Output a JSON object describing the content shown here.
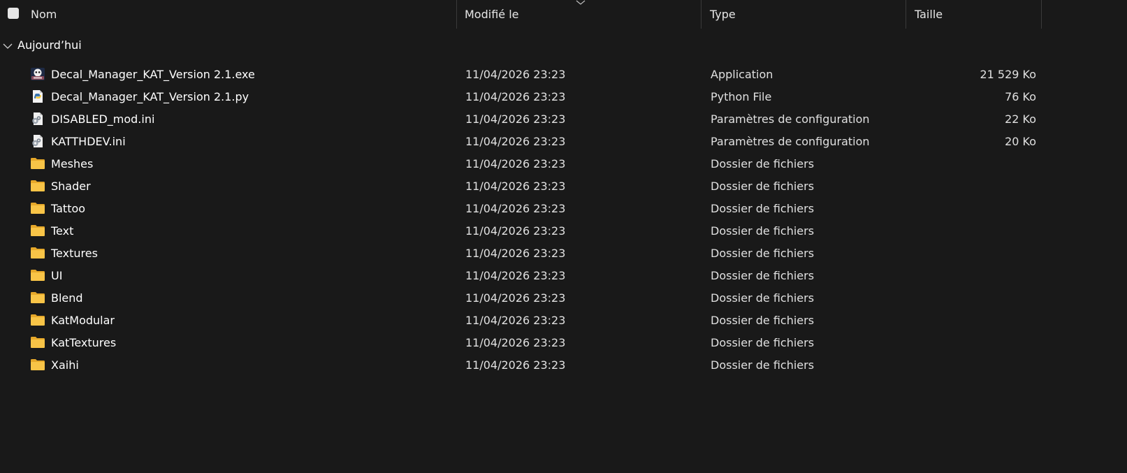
{
  "header": {
    "columns": {
      "name": "Nom",
      "modified": "Modifié le",
      "type": "Type",
      "size": "Taille"
    }
  },
  "group": {
    "label": "Aujourd’hui"
  },
  "colors": {
    "background": "#191919",
    "folder": "#f8c447",
    "folder_dark": "#e6a82a",
    "text": "#ffffff",
    "divider": "#3a3a3a"
  },
  "files": [
    {
      "name": "Decal_Manager_KAT_Version 2.1.exe",
      "modified": "11/04/2026 23:23",
      "type": "Application",
      "size": "21 529 Ko",
      "icon": "app-exe-icon"
    },
    {
      "name": "Decal_Manager_KAT_Version 2.1.py",
      "modified": "11/04/2026 23:23",
      "type": "Python File",
      "size": "76 Ko",
      "icon": "python-file-icon"
    },
    {
      "name": "DISABLED_mod.ini",
      "modified": "11/04/2026 23:23",
      "type": "Paramètres de configuration",
      "size": "22 Ko",
      "icon": "config-file-icon"
    },
    {
      "name": "KATTHDEV.ini",
      "modified": "11/04/2026 23:23",
      "type": "Paramètres de configuration",
      "size": "20 Ko",
      "icon": "config-file-icon"
    },
    {
      "name": "Meshes",
      "modified": "11/04/2026 23:23",
      "type": "Dossier de fichiers",
      "size": "",
      "icon": "folder-icon"
    },
    {
      "name": "Shader",
      "modified": "11/04/2026 23:23",
      "type": "Dossier de fichiers",
      "size": "",
      "icon": "folder-icon"
    },
    {
      "name": "Tattoo",
      "modified": "11/04/2026 23:23",
      "type": "Dossier de fichiers",
      "size": "",
      "icon": "folder-icon"
    },
    {
      "name": "Text",
      "modified": "11/04/2026 23:23",
      "type": "Dossier de fichiers",
      "size": "",
      "icon": "folder-icon"
    },
    {
      "name": "Textures",
      "modified": "11/04/2026 23:23",
      "type": "Dossier de fichiers",
      "size": "",
      "icon": "folder-icon"
    },
    {
      "name": "UI",
      "modified": "11/04/2026 23:23",
      "type": "Dossier de fichiers",
      "size": "",
      "icon": "folder-icon"
    },
    {
      "name": "Blend",
      "modified": "11/04/2026 23:23",
      "type": "Dossier de fichiers",
      "size": "",
      "icon": "folder-icon"
    },
    {
      "name": "KatModular",
      "modified": "11/04/2026 23:23",
      "type": "Dossier de fichiers",
      "size": "",
      "icon": "folder-icon"
    },
    {
      "name": "KatTextures",
      "modified": "11/04/2026 23:23",
      "type": "Dossier de fichiers",
      "size": "",
      "icon": "folder-icon"
    },
    {
      "name": "Xaihi",
      "modified": "11/04/2026 23:23",
      "type": "Dossier de fichiers",
      "size": "",
      "icon": "folder-icon"
    }
  ]
}
